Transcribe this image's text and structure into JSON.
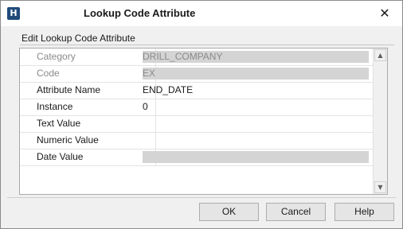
{
  "window": {
    "title": "Lookup Code Attribute",
    "app_icon": "app-logo-icon",
    "close_glyph": "✕"
  },
  "group": {
    "label": "Edit Lookup Code Attribute"
  },
  "rows": [
    {
      "label": "Category",
      "value": "DRILL_COMPANY",
      "readonly": true
    },
    {
      "label": "Code",
      "value": "EX",
      "readonly": true
    },
    {
      "label": "Attribute Name",
      "value": "END_DATE",
      "readonly": false
    },
    {
      "label": "Instance",
      "value": "0",
      "readonly": false
    },
    {
      "label": "Text Value",
      "value": "",
      "readonly": false
    },
    {
      "label": "Numeric Value",
      "value": "",
      "readonly": false
    },
    {
      "label": "Date Value",
      "value": "",
      "readonly": true
    }
  ],
  "scroll": {
    "up_glyph": "▲",
    "down_glyph": "▼"
  },
  "buttons": {
    "ok": "OK",
    "cancel": "Cancel",
    "help": "Help"
  }
}
